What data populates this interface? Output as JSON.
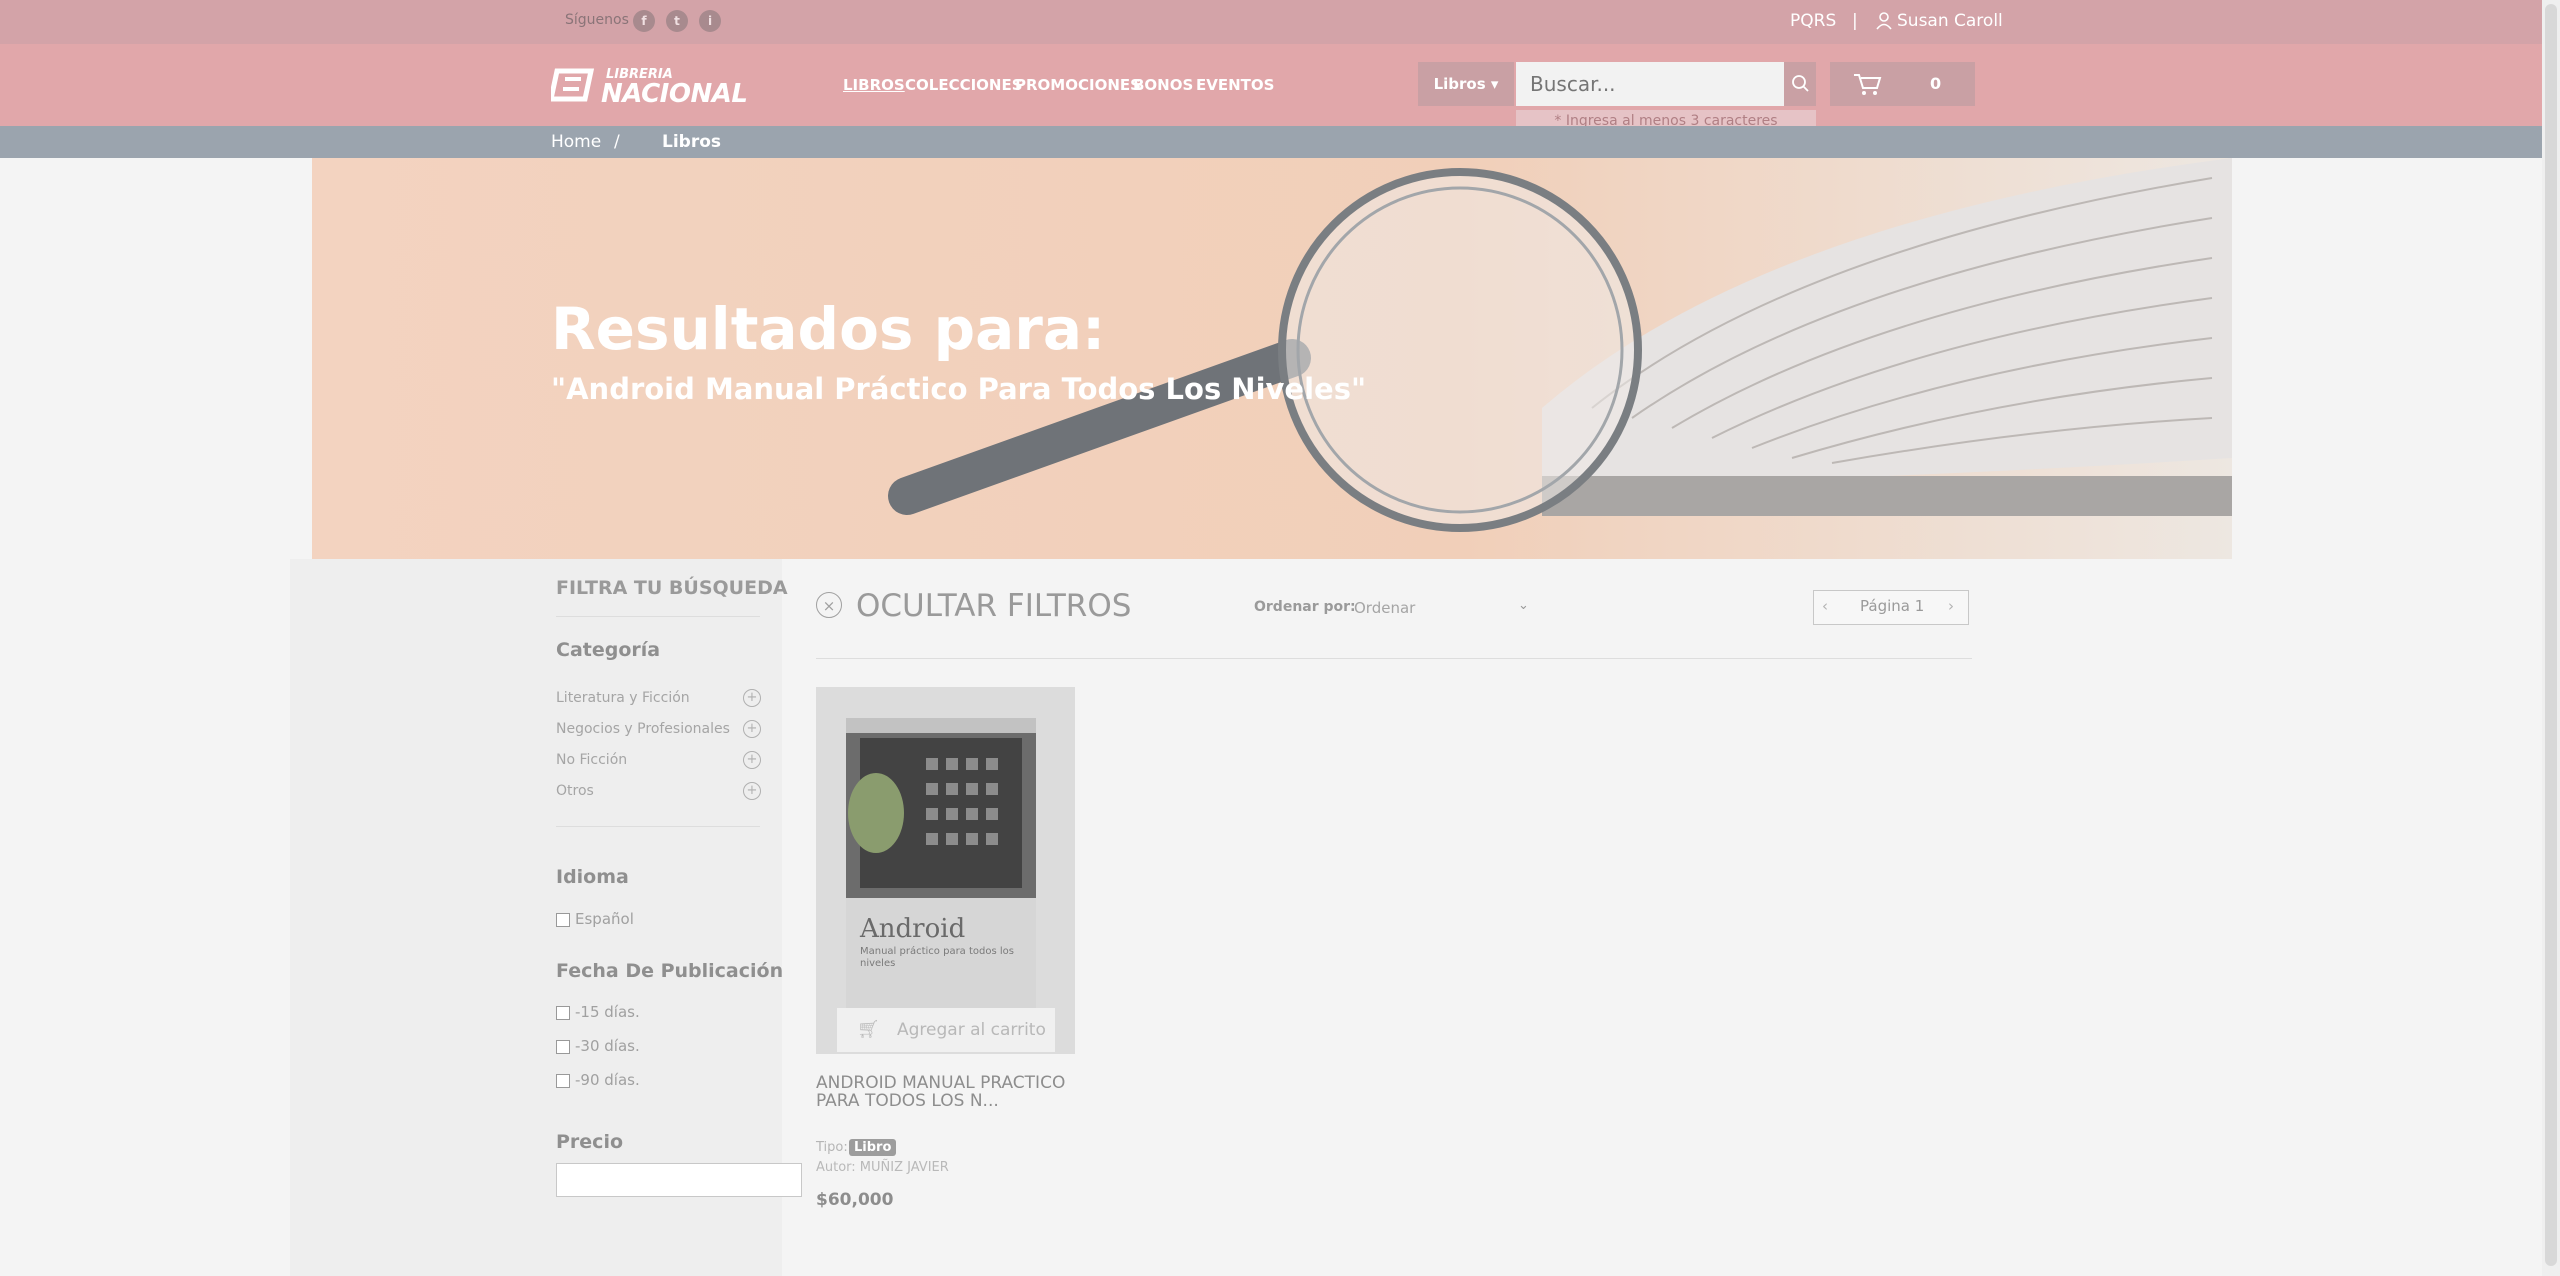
{
  "topbar": {
    "follow_label": "Síguenos",
    "social": [
      "f",
      "t",
      "i"
    ],
    "pqrs": "PQRS",
    "separator": "|",
    "user_name": "Susan Caroll"
  },
  "header": {
    "logo_top": "LIBRERIA",
    "logo_main": "NACIONAL",
    "nav": [
      "LIBROS",
      "COLECCIONES",
      "PROMOCIONES",
      "BONOS",
      "EVENTOS"
    ],
    "category_button": "Libros ▾",
    "search_placeholder": "Buscar...",
    "search_hint": "* Ingresa al menos 3 caracteres",
    "cart_count": "0"
  },
  "breadcrumb": {
    "home": "Home",
    "separator": "/",
    "current": "Libros"
  },
  "hero": {
    "title": "Resultados para:",
    "query": "\"Android Manual Práctico Para Todos Los Niveles\""
  },
  "filters": {
    "title": "FILTRA TU BÚSQUEDA",
    "category_title": "Categoría",
    "categories": [
      "Literatura y Ficción",
      "Negocios y Profesionales",
      "No Ficción",
      "Otros"
    ],
    "language_title": "Idioma",
    "languages": [
      "Español"
    ],
    "date_title": "Fecha De Publicación",
    "dates": [
      "-15 días.",
      "-30 días.",
      "-90 días."
    ],
    "price_title": "Precio"
  },
  "toolbar": {
    "hide_filters": "OCULTAR FILTROS",
    "sort_label": "Ordenar por:",
    "sort_value": "Ordenar",
    "page_label": "Página 1"
  },
  "product": {
    "add_to_cart": "Agregar al carrito",
    "name": "ANDROID MANUAL PRACTICO PARA TODOS LOS N...",
    "type_label": "Tipo:",
    "type_value": "Libro",
    "author": "Autor: MUÑIZ JAVIER",
    "price": "$60,000",
    "cover_title": "Android",
    "cover_subtitle": "Manual práctico para todos los niveles"
  }
}
